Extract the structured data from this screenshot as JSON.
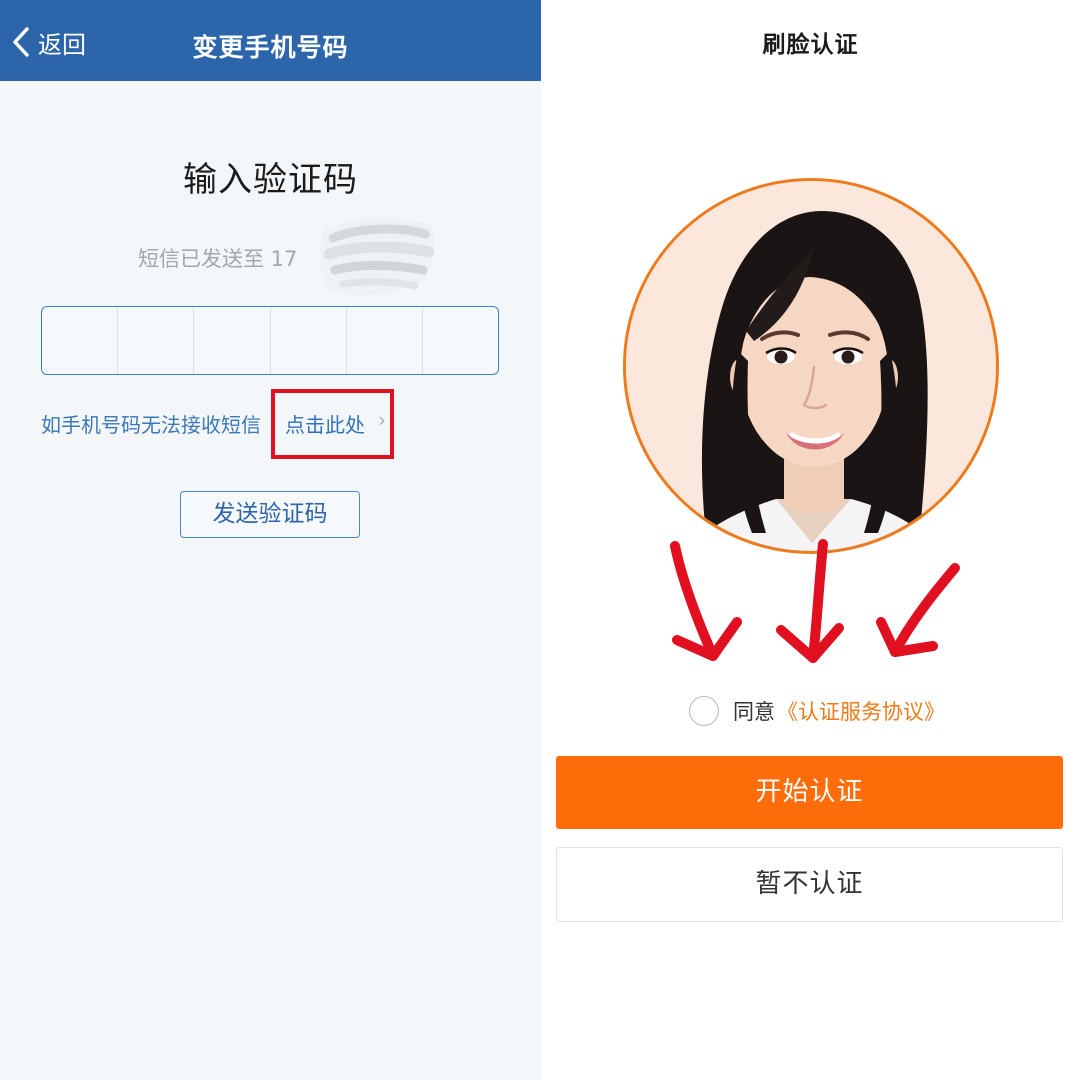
{
  "left_screen": {
    "header": {
      "back_label": "返回",
      "back_icon": "chevron-left-icon",
      "title": "变更手机号码"
    },
    "heading": "输入验证码",
    "sms_sent_text": "短信已发送至 17",
    "code_input": {
      "cells": [
        "",
        "",
        "",
        "",
        "",
        ""
      ]
    },
    "cannot_receive_text": "如手机号码无法接收短信",
    "click_here_label": "点击此处",
    "click_here_chevron": "›",
    "send_code_button": "发送验证码",
    "colors": {
      "header_bg": "#2d65aa",
      "page_bg": "#f3f7f9",
      "link": "#2f72bf",
      "highlight_box": "#e01020"
    }
  },
  "right_screen": {
    "title": "刷脸认证",
    "agree_prefix": "同意",
    "agreement_link": "《认证服务协议》",
    "agree_checked": false,
    "start_button": "开始认证",
    "skip_button": "暂不认证",
    "portrait_icon": "face-portrait",
    "annotation_icon": "red-arrow-down-icon",
    "colors": {
      "accent": "#ff6d0a",
      "portrait_ring": "#f07a1a",
      "annotation_arrows": "#e01020"
    }
  }
}
